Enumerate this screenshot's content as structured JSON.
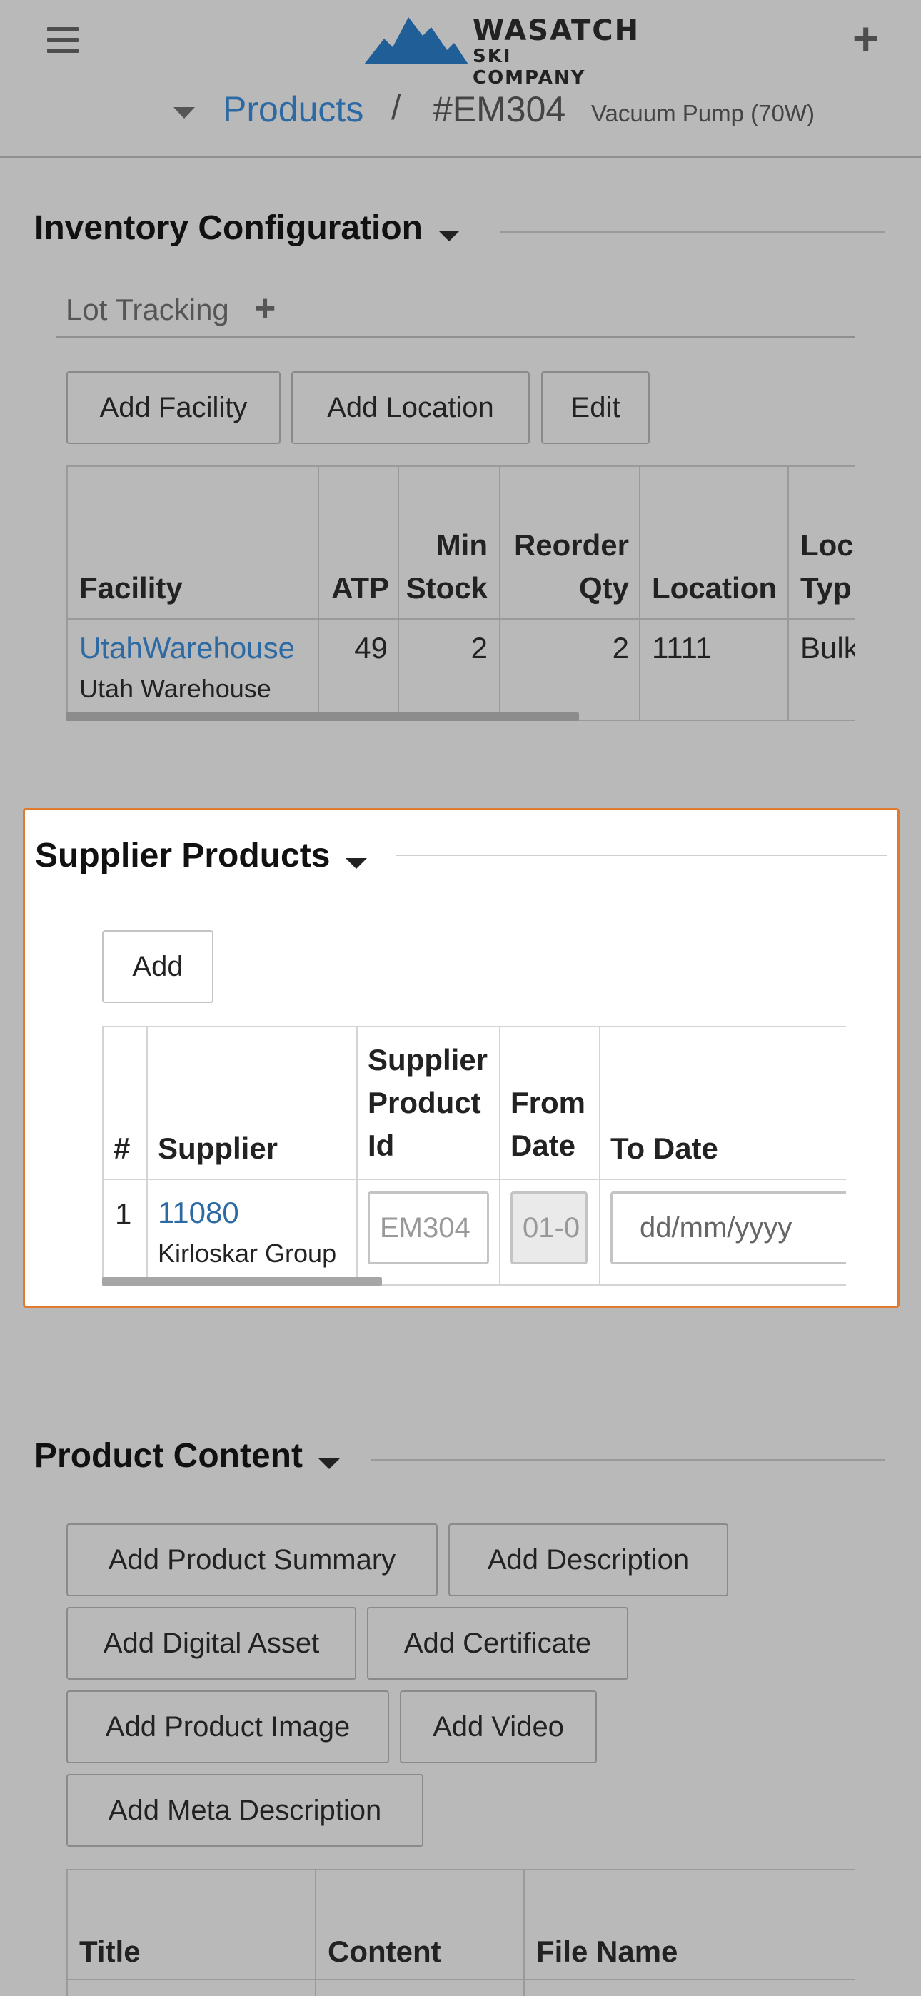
{
  "header": {
    "brand_line1": "WASATCH",
    "brand_line2": "SKI COMPANY",
    "menu_icon": "hamburger-menu-icon",
    "add_icon": "plus-icon"
  },
  "breadcrumb": {
    "section": "Products",
    "separator": "/",
    "product_id": "#EM304",
    "product_name": "Vacuum Pump (70W)"
  },
  "inventory": {
    "title": "Inventory Configuration",
    "lot_tracking_label": "Lot Tracking",
    "buttons": [
      "Add Facility",
      "Add Location",
      "Edit"
    ],
    "columns": [
      "Facility",
      "ATP",
      "Min Stock",
      "Reorder Qty",
      "Location",
      "Location Type"
    ],
    "columns_display": {
      "facility": "Facility",
      "atp": "ATP",
      "min_stock_1": "Min",
      "min_stock_2": "Stock",
      "reorder_1": "Reorder",
      "reorder_2": "Qty",
      "location": "Location",
      "loc_type_1": "Loca",
      "loc_type_2": "Typ"
    },
    "rows": [
      {
        "facility_id": "UtahWarehouse",
        "facility_name": "Utah Warehouse",
        "atp": "49",
        "min_stock": "2",
        "reorder_qty": "2",
        "location": "1111",
        "location_type": "Bulk"
      }
    ]
  },
  "supplier_products": {
    "title": "Supplier Products",
    "add_label": "Add",
    "columns": {
      "num": "#",
      "supplier": "Supplier",
      "spid_1": "Supplier",
      "spid_2": "Product",
      "spid_3": "Id",
      "from_1": "From",
      "from_2": "Date",
      "to_date": "To Date"
    },
    "rows": [
      {
        "num": "1",
        "supplier_id": "11080",
        "supplier_name": "Kirloskar Group",
        "supplier_product_id_placeholder": "EM304",
        "from_date": "01-0",
        "to_date_placeholder": "dd/mm/yyyy"
      }
    ]
  },
  "product_content": {
    "title": "Product Content",
    "buttons": [
      "Add Product Summary",
      "Add Description",
      "Add Digital Asset",
      "Add Certificate",
      "Add Product Image",
      "Add Video",
      "Add Meta Description"
    ],
    "columns": [
      "Title",
      "Content",
      "File Name"
    ]
  }
}
